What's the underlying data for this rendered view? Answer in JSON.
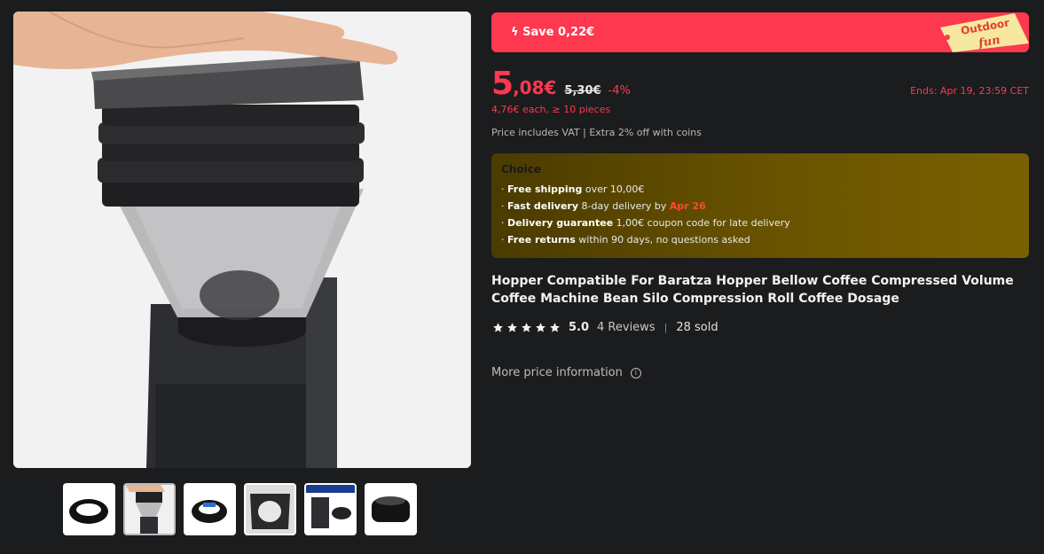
{
  "gallery": {
    "main_image_alt": "coffee grinder with bellows hopper",
    "thumbnails": [
      {
        "icon": "black-bellow-ring"
      },
      {
        "icon": "grinder-with-hand",
        "active": true
      },
      {
        "icon": "bellow-with-blue-tag"
      },
      {
        "icon": "grinder-top-view"
      },
      {
        "icon": "product-info-card"
      },
      {
        "icon": "black-bellow-ring-side"
      }
    ]
  },
  "promo": {
    "save_label": "Save 0,22€",
    "tag_line1": "Outdoor",
    "tag_line2": "fun"
  },
  "price": {
    "current_int": "5",
    "current_dec": ",08€",
    "original": "5,30€",
    "discount": "-4%",
    "ends": "Ends: Apr 19, 23:59 CET",
    "bulk": "4,76€ each, ≥ 10 pieces",
    "vat": "Price includes VAT | Extra 2% off with coins"
  },
  "choice": {
    "title": "Choice",
    "free_shipping_label": "Free shipping",
    "free_shipping_text": " over 10,00€",
    "fast_delivery_label": "Fast delivery",
    "fast_delivery_text": " 8-day delivery by ",
    "fast_delivery_date": "Apr 26",
    "guarantee_label": "Delivery guarantee",
    "guarantee_text": "  1,00€ coupon code for late delivery",
    "returns_label": "Free returns",
    "returns_text": "  within 90 days, no questions asked"
  },
  "product": {
    "title": "Hopper Compatible For Baratza Hopper Bellow Coffee Compressed Volume Coffee Machine Bean Silo Compression Roll Coffee Dosage",
    "rating": "5.0",
    "stars": 5,
    "reviews": "4 Reviews",
    "sold": "28 sold",
    "more_price": "More price information"
  },
  "colors": {
    "accent": "#fd384f",
    "background": "#1b1c1e",
    "choice_gold": "#6a5400"
  }
}
